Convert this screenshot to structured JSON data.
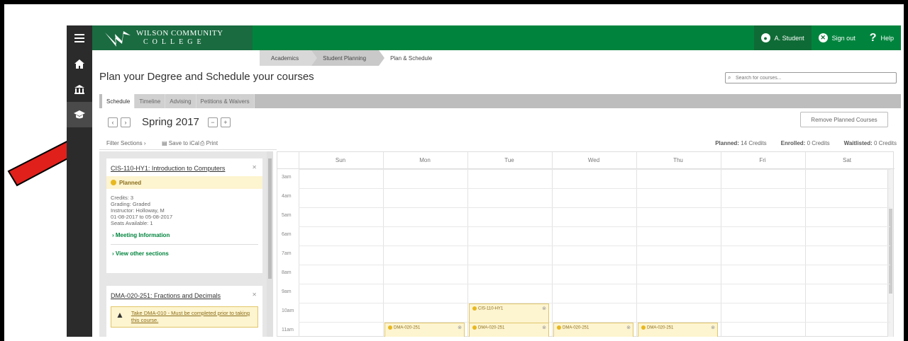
{
  "header": {
    "logo_line1": "WILSON COMMUNITY",
    "logo_line2": "COLLEGE",
    "user_label": "A. Student",
    "signout_label": "Sign out",
    "help_label": "Help"
  },
  "rail": {
    "icons": [
      "menu-icon",
      "home-icon",
      "bank-icon",
      "graduation-cap-icon"
    ]
  },
  "breadcrumbs": [
    "Academics",
    "Student Planning",
    "Plan & Schedule"
  ],
  "page_title": "Plan your Degree and Schedule your courses",
  "search_placeholder": "Search for courses...",
  "tabs": [
    "Schedule",
    "Timeline",
    "Advising",
    "Petitions & Waivers"
  ],
  "term": {
    "name": "Spring 2017",
    "prev": "‹",
    "next": "›",
    "minus": "−",
    "plus": "+"
  },
  "remove_button": "Remove Planned Courses",
  "filter_bar": {
    "filter": "Filter Sections ›",
    "ical": "Save to iCal",
    "print": "Print",
    "planned_label": "Planned:",
    "planned_value": "14 Credits",
    "enrolled_label": "Enrolled:",
    "enrolled_value": "0 Credits",
    "waitlisted_label": "Waitlisted:",
    "waitlisted_value": "0 Credits"
  },
  "courses": [
    {
      "title": "CIS-110-HY1: Introduction to Computers",
      "status": "Planned",
      "credits": "Credits: 3",
      "grading": "Grading: Graded",
      "instructor": "Instructor: Holloway, M",
      "dates": "01-08-2017 to 05-08-2017",
      "seats": "Seats Available: 1",
      "meeting_link": "Meeting Information",
      "other_link": "View other sections"
    },
    {
      "title": "DMA-020-251: Fractions and Decimals",
      "warning": "Take DMA-010 - Must be completed prior to taking this course."
    }
  ],
  "calendar": {
    "days": [
      "Sun",
      "Mon",
      "Tue",
      "Wed",
      "Thu",
      "Fri",
      "Sat"
    ],
    "hours": [
      "3am",
      "4am",
      "5am",
      "6am",
      "7am",
      "8am",
      "9am",
      "10am",
      "11am"
    ],
    "events": [
      {
        "label": "CIS-110-HY1",
        "day": "Tue",
        "hour": "10am"
      },
      {
        "label": "DMA-020-251",
        "day": "Mon",
        "hour": "11am"
      },
      {
        "label": "DMA-020-251",
        "day": "Tue",
        "hour": "11am"
      },
      {
        "label": "DMA-020-251",
        "day": "Wed",
        "hour": "11am"
      },
      {
        "label": "DMA-020-251",
        "day": "Thu",
        "hour": "11am"
      }
    ]
  },
  "colors": {
    "brand_green": "#00843d",
    "planned_yellow": "#fdf4d0",
    "arrow_red": "#e0201b"
  }
}
